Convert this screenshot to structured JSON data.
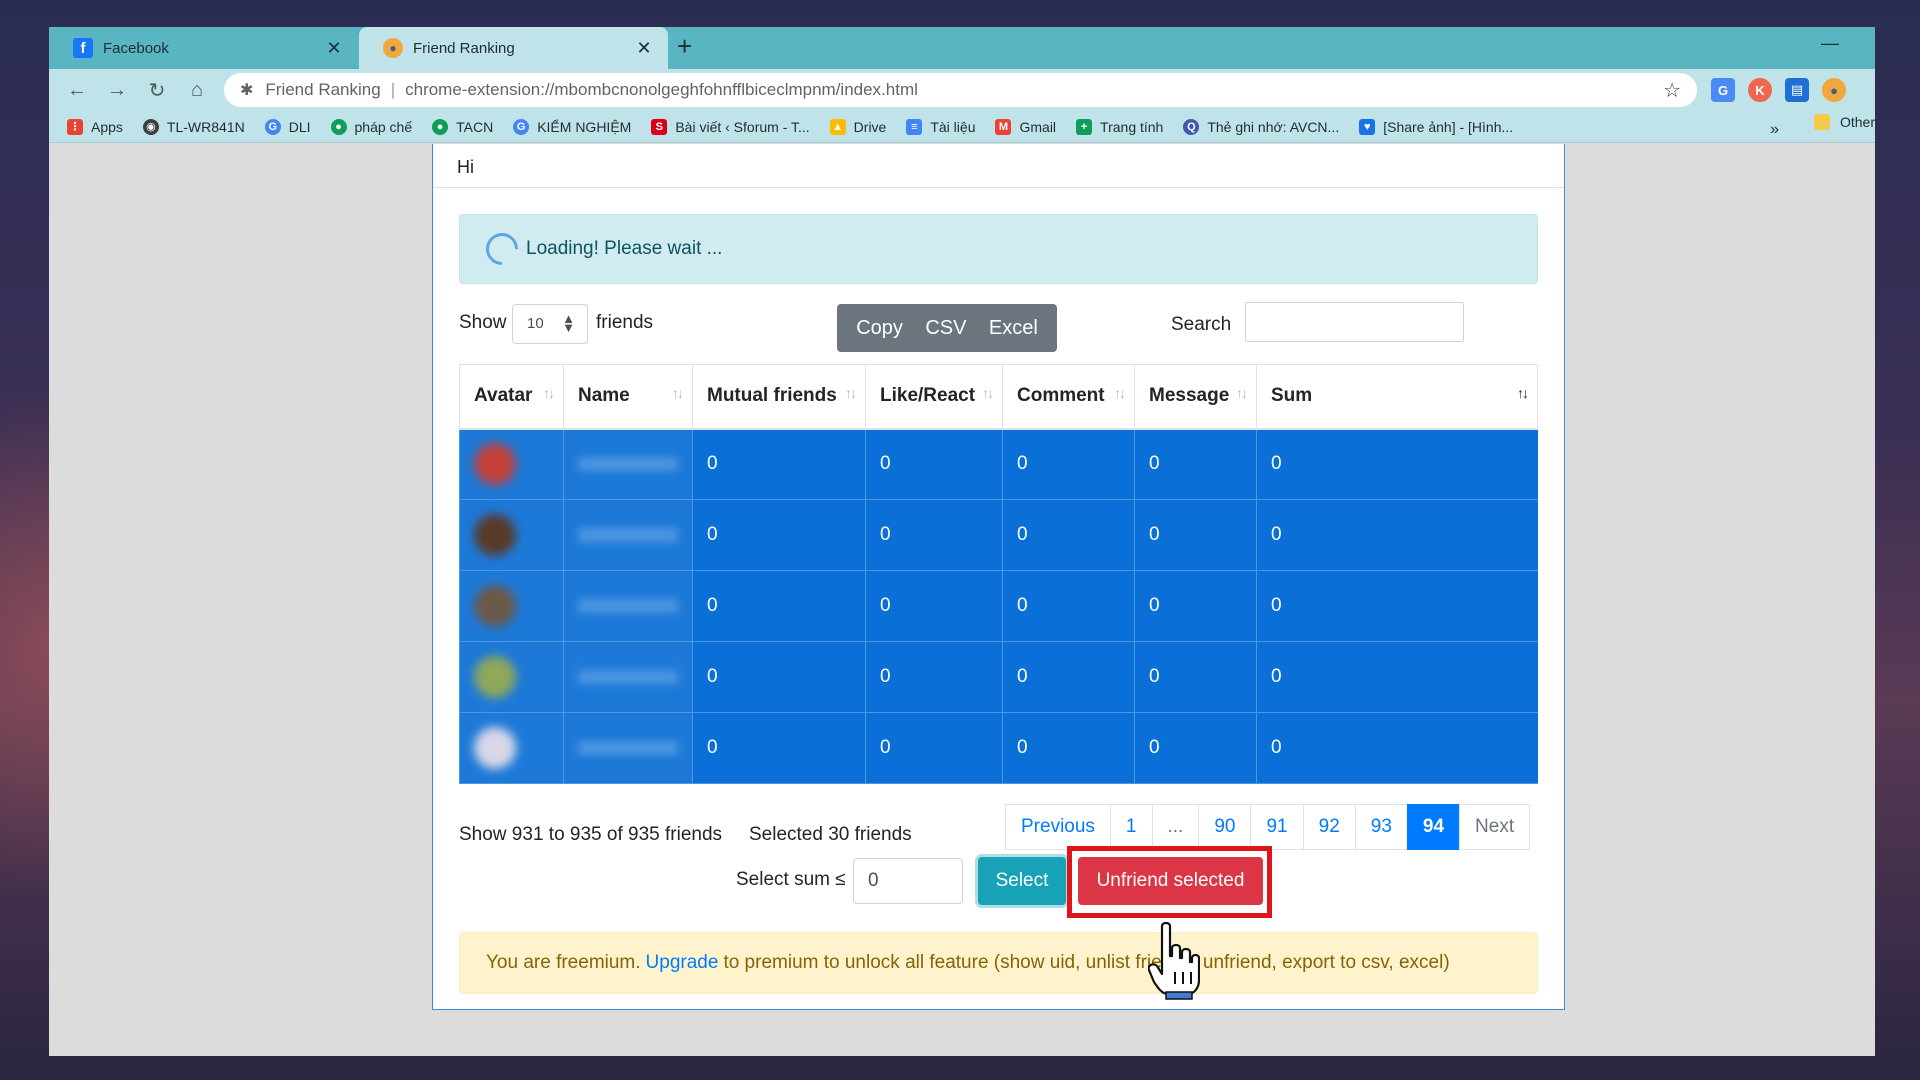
{
  "tabs": [
    {
      "title": "Facebook",
      "active": false
    },
    {
      "title": "Friend Ranking",
      "active": true
    }
  ],
  "new_tab_symbol": "+",
  "address_bar": {
    "site_label": "Friend Ranking",
    "url": "chrome-extension://mbombcnonolgeghfohnfflbiceclmpnm/index.html"
  },
  "bookmarks": [
    {
      "label": "Apps",
      "icon": "apps-grid-icon",
      "color": "#ea4335"
    },
    {
      "label": "TL-WR841N",
      "icon": "globe-icon",
      "color": "#3c4043"
    },
    {
      "label": "DLI",
      "icon": "google-icon",
      "color": "#4285f4"
    },
    {
      "label": "pháp chế",
      "icon": "chat-icon",
      "color": "#0f9d58"
    },
    {
      "label": "TACN",
      "icon": "chat-icon",
      "color": "#0f9d58"
    },
    {
      "label": "KIỂM NGHIỆM",
      "icon": "google-icon",
      "color": "#4285f4"
    },
    {
      "label": "Bài viết ‹ Sforum - T...",
      "icon": "sforum-icon",
      "color": "#d70018"
    },
    {
      "label": "Drive",
      "icon": "drive-icon",
      "color": "#fbbc04"
    },
    {
      "label": "Tài liệu",
      "icon": "docs-icon",
      "color": "#4285f4"
    },
    {
      "label": "Gmail",
      "icon": "gmail-icon",
      "color": "#ea4335"
    },
    {
      "label": "Trang tính",
      "icon": "sheets-icon",
      "color": "#0f9d58"
    },
    {
      "label": "Thẻ ghi nhớ: AVCN...",
      "icon": "quizlet-icon",
      "color": "#4257b2"
    },
    {
      "label": "[Share ảnh] - [Hình...",
      "icon": "image-icon",
      "color": "#1a73e8"
    }
  ],
  "bookmarks_more": "»",
  "bookmarks_other": "Other",
  "page": {
    "greeting": "Hi",
    "loading_text": "Loading! Please wait ...",
    "show_label": "Show",
    "page_size": "10",
    "friends_label": "friends",
    "export_buttons": [
      "Copy",
      "CSV",
      "Excel"
    ],
    "search_label": "Search",
    "search_value": "",
    "table": {
      "columns": [
        "Avatar",
        "Name",
        "Mutual friends",
        "Like/React",
        "Comment",
        "Message",
        "Sum"
      ],
      "rows": [
        {
          "mutual": "0",
          "like": "0",
          "comment": "0",
          "message": "0",
          "sum": "0",
          "avatar_color": "#c2413a"
        },
        {
          "mutual": "0",
          "like": "0",
          "comment": "0",
          "message": "0",
          "sum": "0",
          "avatar_color": "#5a3a2a"
        },
        {
          "mutual": "0",
          "like": "0",
          "comment": "0",
          "message": "0",
          "sum": "0",
          "avatar_color": "#6b5a48"
        },
        {
          "mutual": "0",
          "like": "0",
          "comment": "0",
          "message": "0",
          "sum": "0",
          "avatar_color": "#8fa85a"
        },
        {
          "mutual": "0",
          "like": "0",
          "comment": "0",
          "message": "0",
          "sum": "0",
          "avatar_color": "#d8d8e8"
        }
      ]
    },
    "info_text": "Show 931 to 935 of 935 friends",
    "selected_text": "Selected 30 friends",
    "pagination": [
      "Previous",
      "1",
      "...",
      "90",
      "91",
      "92",
      "93",
      "94",
      "Next"
    ],
    "pagination_active": "94",
    "select_sum_label": "Select sum ≤",
    "select_sum_value": "0",
    "select_button": "Select",
    "unfriend_button": "Unfriend selected",
    "premium_before": "You are freemium.",
    "premium_link": "Upgrade",
    "premium_after": "to premium to unlock all feature (show uid, unlist friends, unfriend, export to csv, excel)"
  }
}
